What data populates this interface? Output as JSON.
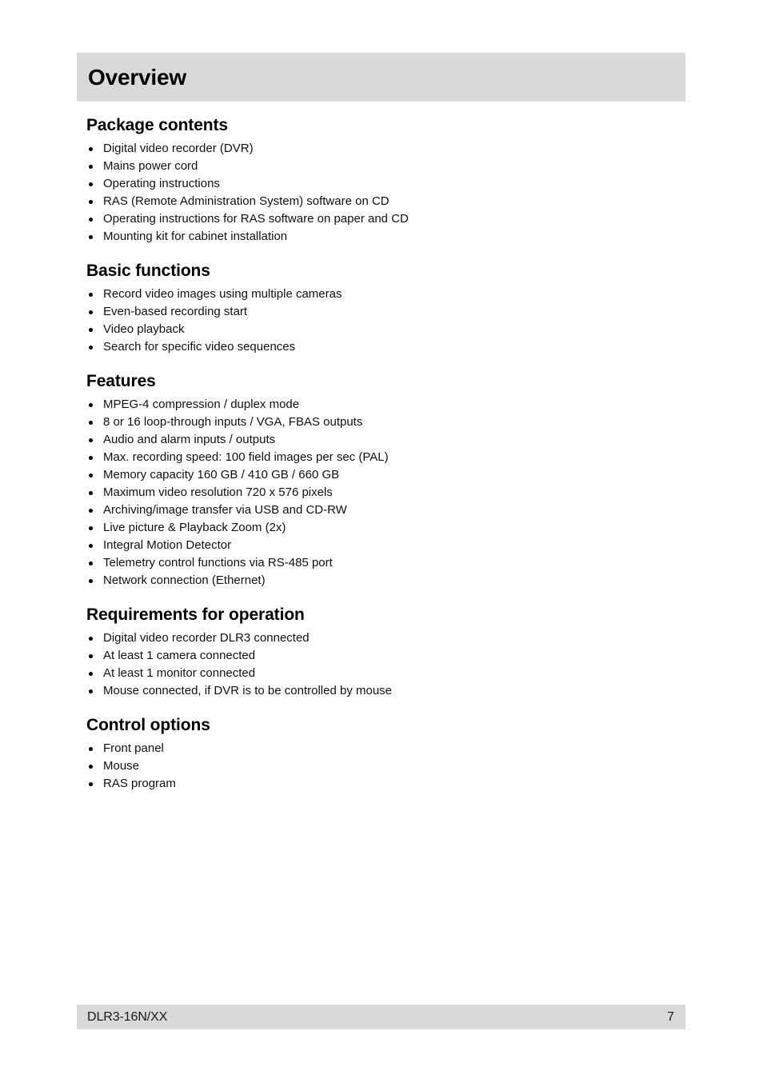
{
  "page": {
    "chapter_title": "Overview",
    "banner_color": "#d9d9d9",
    "text_color": "#000000"
  },
  "sections": [
    {
      "heading": "Package contents",
      "items": [
        "Digital video recorder (DVR)",
        "Mains power cord",
        "Operating instructions",
        "RAS (Remote Administration System) software on CD",
        "Operating instructions for RAS software on paper and CD",
        "Mounting kit for cabinet installation"
      ]
    },
    {
      "heading": "Basic functions",
      "items": [
        "Record video images using multiple cameras",
        "Even-based recording start",
        "Video playback",
        "Search for specific video sequences"
      ]
    },
    {
      "heading": "Features",
      "items": [
        "MPEG-4 compression / duplex mode",
        "8 or 16 loop-through inputs / VGA, FBAS outputs",
        "Audio and alarm inputs / outputs",
        "Max. recording speed: 100 field images per sec (PAL)",
        "Memory capacity 160 GB / 410 GB / 660 GB",
        "Maximum video resolution 720 x 576 pixels",
        "Archiving/image transfer via USB and CD-RW",
        "Live picture & Playback Zoom (2x)",
        "Integral Motion Detector",
        "Telemetry control functions via RS-485 port",
        "Network connection (Ethernet)"
      ]
    },
    {
      "heading": "Requirements for operation",
      "items": [
        "Digital video recorder DLR3 connected",
        "At least 1 camera connected",
        "At least 1 monitor connected",
        "Mouse connected, if DVR is to be controlled by mouse"
      ]
    },
    {
      "heading": "Control options",
      "items": [
        "Front panel",
        "Mouse",
        "RAS program"
      ]
    }
  ],
  "footer": {
    "model": "DLR3-16N/XX",
    "page_number": "7"
  }
}
